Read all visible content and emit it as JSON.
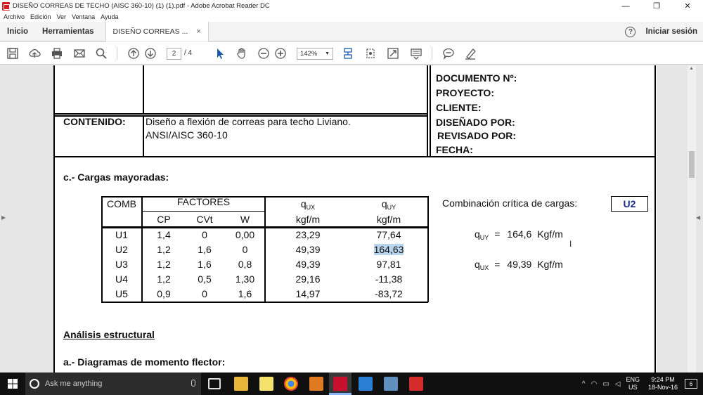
{
  "window": {
    "title": "DISEÑO CORREAS DE TECHO (AISC 360-10) (1) (1).pdf - Adobe Acrobat Reader DC",
    "minimize": "—",
    "restore": "❐",
    "close": "✕"
  },
  "menu": [
    "Archivo",
    "Edición",
    "Ver",
    "Ventana",
    "Ayuda"
  ],
  "tabs": {
    "home": "Inicio",
    "tools": "Herramientas",
    "document": "DISEÑO CORREAS ...",
    "close": "×",
    "help": "?",
    "sign_in": "Iniciar sesión"
  },
  "toolbar": {
    "page_current": "2",
    "page_total": "/ 4",
    "zoom": "142%",
    "zoom_arrow": "▼"
  },
  "header": {
    "right_labels": [
      "DOCUMENTO Nº:",
      "PROYECTO:",
      "CLIENTE:",
      "DISEÑADO POR:",
      "REVISADO POR:",
      "FECHA:"
    ],
    "contenido_label": "CONTENIDO:",
    "contenido_line1": "Diseño a flexión de correas para techo Liviano.",
    "contenido_line2": "ANSI/AISC 360-10"
  },
  "section_c": "c.- Cargas mayoradas:",
  "table": {
    "comb": "COMB",
    "factores": "FACTORES",
    "cp": "CP",
    "cvt": "CVt",
    "w": "W",
    "qux": "q",
    "qux_sub": "UX",
    "quy": "q",
    "quy_sub": "UY",
    "unit": "kgf/m",
    "rows": [
      {
        "comb": "U1",
        "cp": "1,4",
        "cvt": "0",
        "w": "0,00",
        "qux": "23,29",
        "quy": "77,64"
      },
      {
        "comb": "U2",
        "cp": "1,2",
        "cvt": "1,6",
        "w": "0",
        "qux": "49,39",
        "quy": "164,63"
      },
      {
        "comb": "U3",
        "cp": "1,2",
        "cvt": "1,6",
        "w": "0,8",
        "qux": "49,39",
        "quy": "97,81"
      },
      {
        "comb": "U4",
        "cp": "1,2",
        "cvt": "0,5",
        "w": "1,30",
        "qux": "29,16",
        "quy": "-11,38"
      },
      {
        "comb": "U5",
        "cp": "0,9",
        "cvt": "0",
        "w": "1,6",
        "qux": "14,97",
        "quy": "-83,72"
      }
    ]
  },
  "critical": {
    "label": "Combinación crítica de cargas:",
    "value": "U2",
    "quy_symbol": "q",
    "quy_sub": "UY",
    "quy_eq": "=",
    "quy_value": "164,6",
    "quy_unit": "Kgf/m",
    "qux_symbol": "q",
    "qux_sub": "UX",
    "qux_eq": "=",
    "qux_value": "49,39",
    "qux_unit": "Kgf/m"
  },
  "analysis_title": "Análisis estructural",
  "section_a": "a.- Diagramas de momento flector:",
  "taskbar": {
    "search_placeholder": "Ask me anything",
    "lang_top": "ENG",
    "lang_bottom": "US",
    "time": "9:24 PM",
    "date": "18-Nov-16",
    "notifications": "6"
  }
}
